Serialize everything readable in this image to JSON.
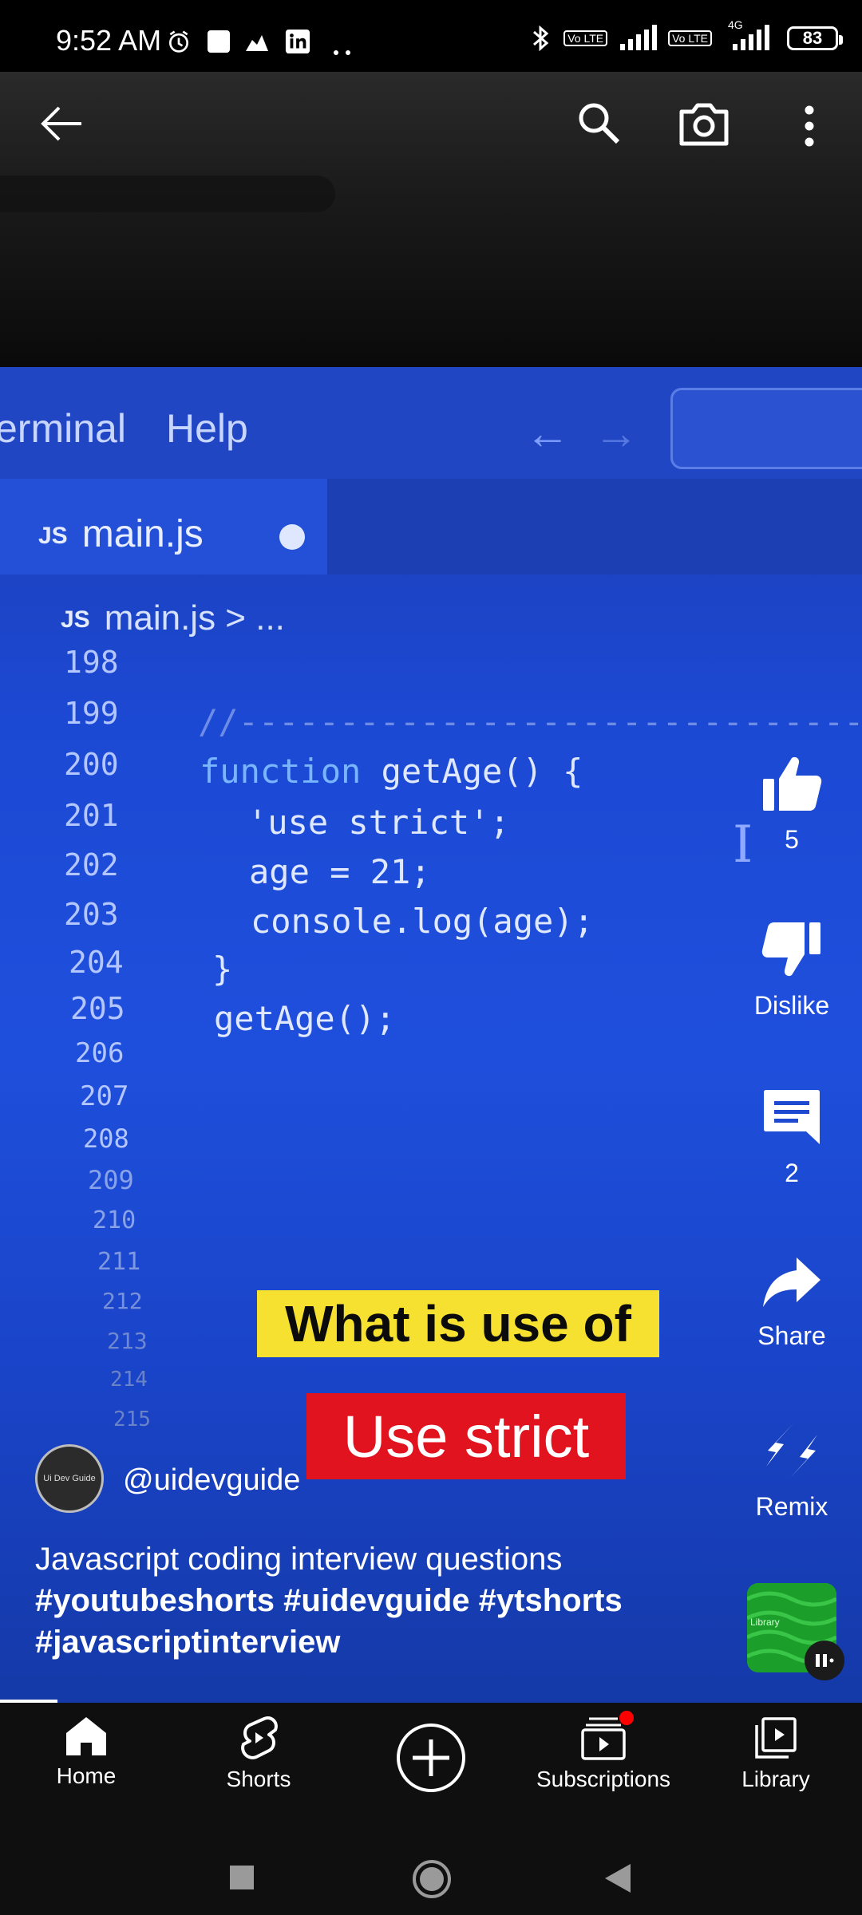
{
  "status_bar": {
    "time": "9:52 AM",
    "network_badges": [
      "Vo LTE",
      "Vo LTE"
    ],
    "network_type": "4G",
    "battery": "83"
  },
  "video": {
    "menu_items": [
      "erminal",
      "Help"
    ],
    "tab_label": "main.js",
    "breadcrumb": "main.js > ...",
    "js_badge": "JS",
    "line_numbers": [
      "198",
      "199",
      "200",
      "201",
      "202",
      "203",
      "204",
      "205",
      "206",
      "207",
      "208",
      "209",
      "210",
      "211",
      "212",
      "213",
      "214",
      "215"
    ],
    "code": {
      "comment": "//-----------------------------------------",
      "fn_keyword": "function",
      "fn_decl": " getAge() {",
      "line1": "'use strict';",
      "line2": "age = 21;",
      "line3": "console.log(age);",
      "line4": "}",
      "line5": "getAge();"
    },
    "caption_top": "What is use of",
    "caption_bottom": "Use strict"
  },
  "actions": {
    "like_count": "5",
    "dislike_label": "Dislike",
    "comment_count": "2",
    "share_label": "Share",
    "remix_label": "Remix"
  },
  "channel": {
    "handle": "@uidevguide",
    "avatar_text": "Ui Dev Guide"
  },
  "description": {
    "title": "Javascript coding interview questions",
    "hashtags": "#youtubeshorts #uidevguide #ytshorts #javascriptinterview"
  },
  "music": {
    "thumb_text": "Library"
  },
  "bottom_nav": {
    "home": "Home",
    "shorts": "Shorts",
    "subscriptions": "Subscriptions",
    "library": "Library"
  },
  "colors": {
    "caption_yellow": "#f6e130",
    "caption_red": "#e1131f",
    "notification_dot": "#ff0000"
  }
}
